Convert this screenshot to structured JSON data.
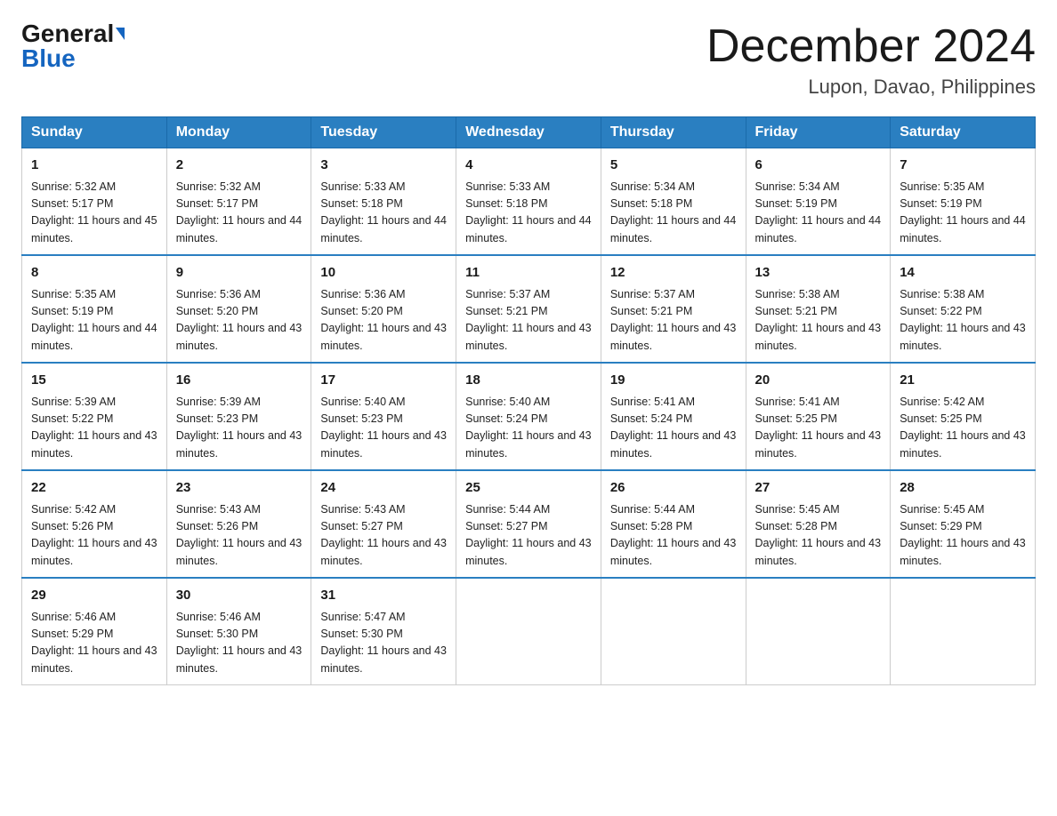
{
  "header": {
    "logo_general": "General",
    "logo_blue": "Blue",
    "month_title": "December 2024",
    "location": "Lupon, Davao, Philippines"
  },
  "days_of_week": [
    "Sunday",
    "Monday",
    "Tuesday",
    "Wednesday",
    "Thursday",
    "Friday",
    "Saturday"
  ],
  "weeks": [
    [
      {
        "day": "1",
        "sunrise": "5:32 AM",
        "sunset": "5:17 PM",
        "daylight": "11 hours and 45 minutes."
      },
      {
        "day": "2",
        "sunrise": "5:32 AM",
        "sunset": "5:17 PM",
        "daylight": "11 hours and 44 minutes."
      },
      {
        "day": "3",
        "sunrise": "5:33 AM",
        "sunset": "5:18 PM",
        "daylight": "11 hours and 44 minutes."
      },
      {
        "day": "4",
        "sunrise": "5:33 AM",
        "sunset": "5:18 PM",
        "daylight": "11 hours and 44 minutes."
      },
      {
        "day": "5",
        "sunrise": "5:34 AM",
        "sunset": "5:18 PM",
        "daylight": "11 hours and 44 minutes."
      },
      {
        "day": "6",
        "sunrise": "5:34 AM",
        "sunset": "5:19 PM",
        "daylight": "11 hours and 44 minutes."
      },
      {
        "day": "7",
        "sunrise": "5:35 AM",
        "sunset": "5:19 PM",
        "daylight": "11 hours and 44 minutes."
      }
    ],
    [
      {
        "day": "8",
        "sunrise": "5:35 AM",
        "sunset": "5:19 PM",
        "daylight": "11 hours and 44 minutes."
      },
      {
        "day": "9",
        "sunrise": "5:36 AM",
        "sunset": "5:20 PM",
        "daylight": "11 hours and 43 minutes."
      },
      {
        "day": "10",
        "sunrise": "5:36 AM",
        "sunset": "5:20 PM",
        "daylight": "11 hours and 43 minutes."
      },
      {
        "day": "11",
        "sunrise": "5:37 AM",
        "sunset": "5:21 PM",
        "daylight": "11 hours and 43 minutes."
      },
      {
        "day": "12",
        "sunrise": "5:37 AM",
        "sunset": "5:21 PM",
        "daylight": "11 hours and 43 minutes."
      },
      {
        "day": "13",
        "sunrise": "5:38 AM",
        "sunset": "5:21 PM",
        "daylight": "11 hours and 43 minutes."
      },
      {
        "day": "14",
        "sunrise": "5:38 AM",
        "sunset": "5:22 PM",
        "daylight": "11 hours and 43 minutes."
      }
    ],
    [
      {
        "day": "15",
        "sunrise": "5:39 AM",
        "sunset": "5:22 PM",
        "daylight": "11 hours and 43 minutes."
      },
      {
        "day": "16",
        "sunrise": "5:39 AM",
        "sunset": "5:23 PM",
        "daylight": "11 hours and 43 minutes."
      },
      {
        "day": "17",
        "sunrise": "5:40 AM",
        "sunset": "5:23 PM",
        "daylight": "11 hours and 43 minutes."
      },
      {
        "day": "18",
        "sunrise": "5:40 AM",
        "sunset": "5:24 PM",
        "daylight": "11 hours and 43 minutes."
      },
      {
        "day": "19",
        "sunrise": "5:41 AM",
        "sunset": "5:24 PM",
        "daylight": "11 hours and 43 minutes."
      },
      {
        "day": "20",
        "sunrise": "5:41 AM",
        "sunset": "5:25 PM",
        "daylight": "11 hours and 43 minutes."
      },
      {
        "day": "21",
        "sunrise": "5:42 AM",
        "sunset": "5:25 PM",
        "daylight": "11 hours and 43 minutes."
      }
    ],
    [
      {
        "day": "22",
        "sunrise": "5:42 AM",
        "sunset": "5:26 PM",
        "daylight": "11 hours and 43 minutes."
      },
      {
        "day": "23",
        "sunrise": "5:43 AM",
        "sunset": "5:26 PM",
        "daylight": "11 hours and 43 minutes."
      },
      {
        "day": "24",
        "sunrise": "5:43 AM",
        "sunset": "5:27 PM",
        "daylight": "11 hours and 43 minutes."
      },
      {
        "day": "25",
        "sunrise": "5:44 AM",
        "sunset": "5:27 PM",
        "daylight": "11 hours and 43 minutes."
      },
      {
        "day": "26",
        "sunrise": "5:44 AM",
        "sunset": "5:28 PM",
        "daylight": "11 hours and 43 minutes."
      },
      {
        "day": "27",
        "sunrise": "5:45 AM",
        "sunset": "5:28 PM",
        "daylight": "11 hours and 43 minutes."
      },
      {
        "day": "28",
        "sunrise": "5:45 AM",
        "sunset": "5:29 PM",
        "daylight": "11 hours and 43 minutes."
      }
    ],
    [
      {
        "day": "29",
        "sunrise": "5:46 AM",
        "sunset": "5:29 PM",
        "daylight": "11 hours and 43 minutes."
      },
      {
        "day": "30",
        "sunrise": "5:46 AM",
        "sunset": "5:30 PM",
        "daylight": "11 hours and 43 minutes."
      },
      {
        "day": "31",
        "sunrise": "5:47 AM",
        "sunset": "5:30 PM",
        "daylight": "11 hours and 43 minutes."
      },
      null,
      null,
      null,
      null
    ]
  ],
  "labels": {
    "sunrise_prefix": "Sunrise: ",
    "sunset_prefix": "Sunset: ",
    "daylight_prefix": "Daylight: "
  }
}
